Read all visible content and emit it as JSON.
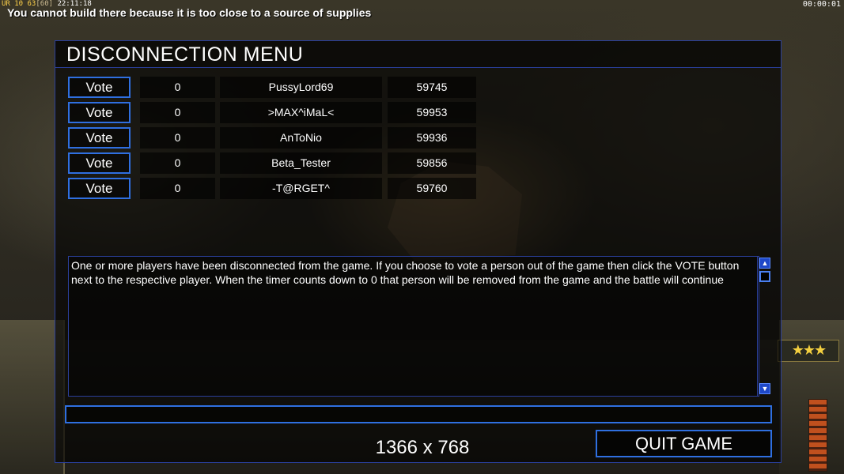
{
  "hud": {
    "stat_a": "UR 10",
    "stat_b": "63",
    "stat_c": "[60]",
    "stat_d": "22:11:18",
    "clock": "00:00:01",
    "message": "You cannot build there because it is too close to a source of supplies"
  },
  "dialog": {
    "title": "DISCONNECTION MENU",
    "vote_label": "Vote",
    "players": [
      {
        "votes": "0",
        "name": "PussyLord69",
        "ping": "59745"
      },
      {
        "votes": "0",
        "name": ">MAX^iMaL<",
        "ping": "59953"
      },
      {
        "votes": "0",
        "name": "AnToNio",
        "ping": "59936"
      },
      {
        "votes": "0",
        "name": "Beta_Tester",
        "ping": "59856"
      },
      {
        "votes": "0",
        "name": "-T@RGET^",
        "ping": "59760"
      }
    ],
    "info_text": "One or more players have been disconnected from the game. If you choose to vote a person out of the game then click the VOTE button next to the respective player. When the timer counts down to 0 that person will be removed from the game and the battle will continue",
    "chat_value": "",
    "resolution": "1366 x 768",
    "quit_label": "QUIT GAME"
  },
  "icons": {
    "scroll_up": "arrow-up-icon",
    "scroll_down": "arrow-down-icon",
    "rank": "stars-icon"
  },
  "colors": {
    "button_border": "#2f6fe0",
    "panel_border": "#2a3f9a",
    "hud_yellow": "#ffd24a"
  }
}
